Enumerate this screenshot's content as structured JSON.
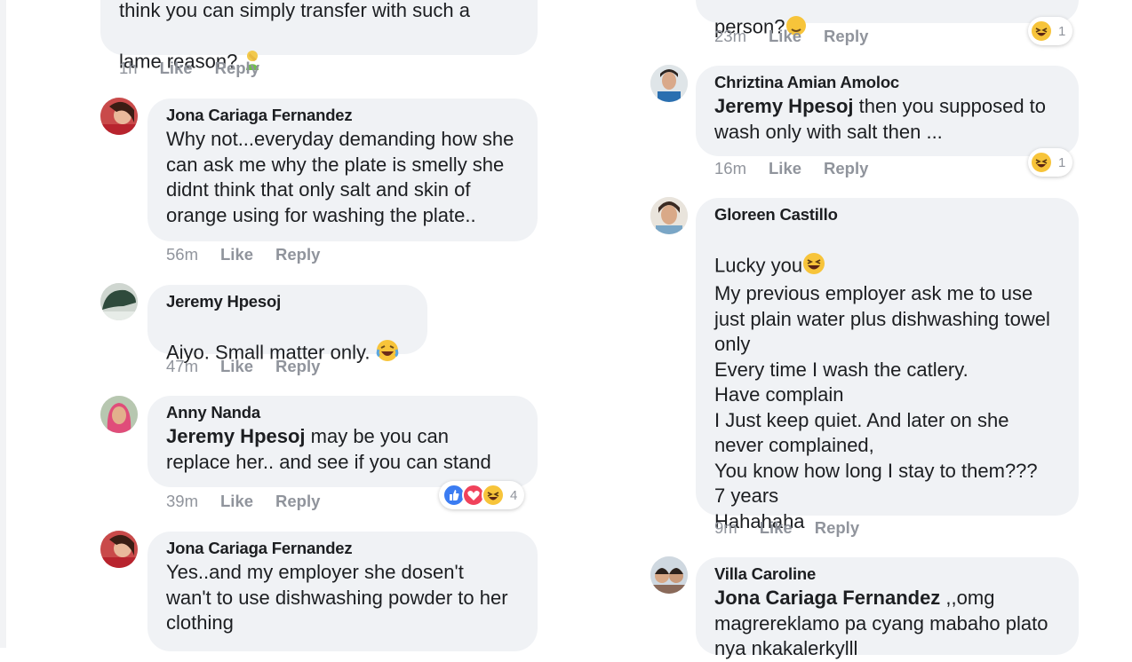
{
  "left_column": [
    {
      "id": "c0",
      "author": "",
      "text_before_tag": "",
      "tag": "",
      "text": "think you can simply transfer with such a\nlame reason?",
      "time": "1h",
      "like": "Like",
      "reply": "Reply"
    },
    {
      "id": "c1",
      "author": "Jona Cariaga Fernandez",
      "tag": "",
      "text": "Why not...everyday demanding how she\ncan ask me why the plate is smelly she\ndidnt think that only salt and skin of\norange using for washing the plate..",
      "time": "56m",
      "like": "Like",
      "reply": "Reply"
    },
    {
      "id": "c2",
      "author": "Jeremy Hpesoj",
      "tag": "",
      "text": "Aiyo. Small matter only.",
      "time": "47m",
      "like": "Like",
      "reply": "Reply"
    },
    {
      "id": "c3",
      "author": "Anny Nanda",
      "tag": "Jeremy Hpesoj",
      "text": "  may be you can\nreplace her.. and see if you can stand",
      "time": "39m",
      "like": "Like",
      "reply": "Reply",
      "reaction_count": "4"
    },
    {
      "id": "c4",
      "author": "Jona Cariaga Fernandez",
      "tag": "",
      "text": "Yes..and my employer she dosen't\nwan't to use dishwashing powder to her\nclothing",
      "time": "",
      "like": "",
      "reply": ""
    }
  ],
  "right_column": [
    {
      "id": "r0",
      "author": "",
      "tag": "",
      "text": "person?",
      "time": "23m",
      "like": "Like",
      "reply": "Reply",
      "reaction_count": "1"
    },
    {
      "id": "r1",
      "author": "Chriztina Amian Amoloc",
      "tag": "Jeremy Hpesoj",
      "text": " then you supposed to\nwash only with salt then ...",
      "time": "16m",
      "like": "Like",
      "reply": "Reply",
      "reaction_count": "1"
    },
    {
      "id": "r2",
      "author": "Gloreen Castillo",
      "tag": "",
      "text_first": "Lucky you",
      "text": "My previous employer ask me to use\njust plain water plus dishwashing towel\nonly\nEvery time I wash the catlery.\nHave complain\nI Just keep quiet. And later on she\nnever complained,\nYou know how long I stay to them???\n7 years\nHahahaha",
      "time": "9m",
      "like": "Like",
      "reply": "Reply"
    },
    {
      "id": "r3",
      "author": "Villa Caroline",
      "tag": "Jona Cariaga Fernandez",
      "text": " ,,omg\nmagrereklamo pa cyang mabaho plato\nnya nkakalerkylll",
      "time": "",
      "like": "",
      "reply": ""
    }
  ],
  "colors": {
    "bubble": "#f0f2f5",
    "meta_text": "#90949c",
    "like_blue": "#3b7cf2",
    "love_red": "#f0425b",
    "haha_yellow": "#f7c43a"
  },
  "icons": [
    "facepalm-emoji-icon",
    "laughing-tears-emoji-icon",
    "grinning-squint-emoji-icon",
    "like-reaction-icon",
    "love-reaction-icon",
    "haha-reaction-icon",
    "wink-emoji-icon"
  ]
}
